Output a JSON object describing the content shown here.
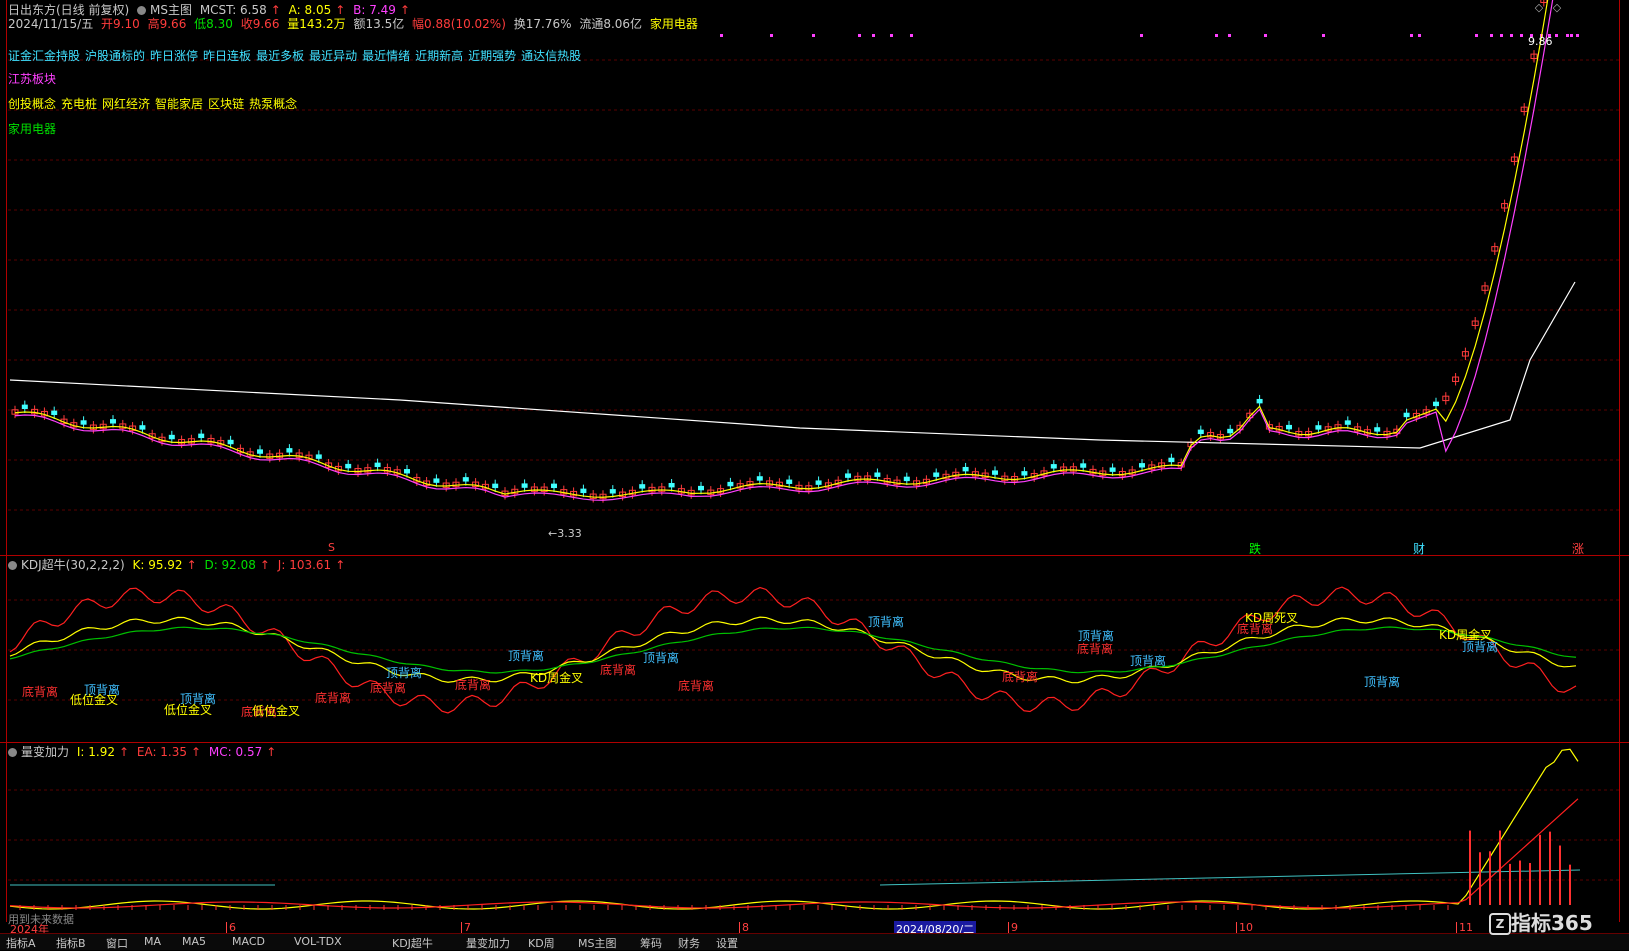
{
  "header": {
    "stock_name": "日出东方(日线 前复权)",
    "main_indicator": "MS主图",
    "mcst_label": "MCST: 6.58",
    "a_label": "A: 8.05",
    "b_label": "B: 7.49",
    "date": "2024/11/15/五",
    "open": "开9.10",
    "high": "高9.66",
    "low": "低8.30",
    "close": "收9.66",
    "volume": "量143.2万",
    "amount": "额13.5亿",
    "change": "幅0.88(10.02%)",
    "turnover": "换17.76%",
    "float_cap": "流通8.06亿",
    "industry": "家用电器"
  },
  "concept_lines": {
    "line1": [
      "证金汇金持股",
      "沪股通标的",
      "昨日涨停",
      "昨日连板",
      "最近多板",
      "最近异动",
      "最近情绪",
      "近期新高",
      "近期强势",
      "通达信热股"
    ],
    "line2": "江苏板块",
    "line3": [
      "创投概念",
      "充电桩",
      "网红经济",
      "智能家居",
      "区块链",
      "热泵概念"
    ],
    "line4": "家用电器"
  },
  "price_labels": {
    "max": "9.86",
    "min": "3.33"
  },
  "event_markers": [
    "S",
    "跌",
    "财",
    "涨"
  ],
  "kdj": {
    "name": "KDJ超牛(30,2,2,2)",
    "k": "K: 95.92",
    "d": "D: 92.08",
    "j": "J: 103.61",
    "signals": [
      "底背离",
      "顶背离",
      "低位金叉",
      "顶背离",
      "低位金叉",
      "底背离",
      "低位金叉",
      "底背离",
      "顶背离",
      "底背离",
      "底背离",
      "顶背离",
      "KD周金叉",
      "底背离",
      "顶背离",
      "底背离",
      "顶背离",
      "底背离",
      "顶背离",
      "底背离",
      "顶背离",
      "KD周死叉",
      "底背离",
      "顶背离",
      "KD周金叉",
      "顶背离"
    ]
  },
  "volume_ind": {
    "name": "量变加力",
    "i": "I: 1.92",
    "ea": "EA: 1.35",
    "mc": "MC: 0.57",
    "watermark": "用到未来数据"
  },
  "date_axis": {
    "labels": [
      "2024年",
      "6",
      "7",
      "8",
      "9",
      "10",
      "11"
    ],
    "cursor_date": "2024/08/20/二"
  },
  "bottom_tabs": [
    "指标A",
    "指标B",
    "窗口",
    "MA",
    "MA5",
    "MACD",
    "VOL-TDX",
    "KDJ超牛",
    "量变加力",
    "KD周",
    "MS主图",
    "筹码",
    "财务",
    "设置"
  ],
  "brand": "指标365",
  "colors": {
    "up": "#ff3c3c",
    "down": "#40ffff",
    "ma_white": "#ffffff",
    "ma_yellow": "#ffff00",
    "ma_magenta": "#ff40ff"
  }
}
